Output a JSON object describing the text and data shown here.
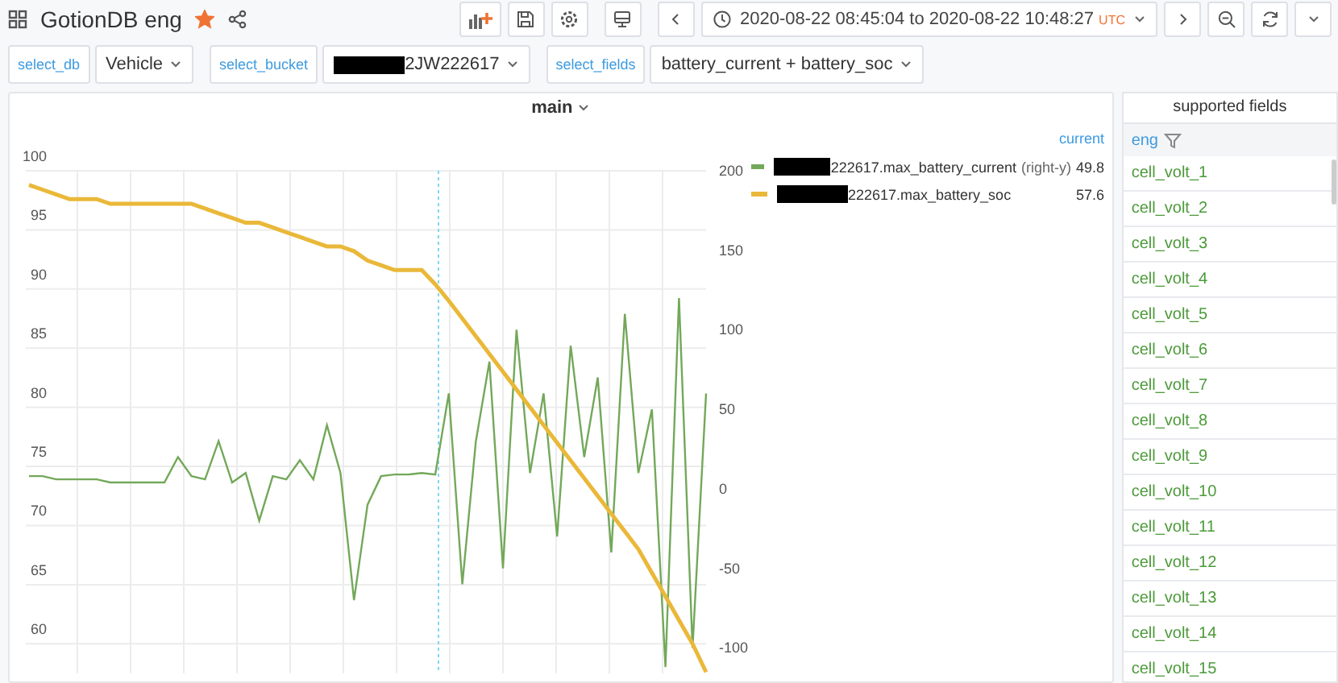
{
  "dashboard": {
    "title": "GotionDB eng",
    "starred": true
  },
  "time_range": {
    "text": "2020-08-22 08:45:04 to 2020-08-22 10:48:27",
    "zone": "UTC"
  },
  "variables": [
    {
      "label": "select_db",
      "value": "Vehicle"
    },
    {
      "label": "select_bucket",
      "value": "2JW222617",
      "redacted": true
    },
    {
      "label": "select_fields",
      "value": "battery_current + battery_soc"
    }
  ],
  "panel": {
    "title": "main",
    "chart_data": {
      "type": "line",
      "grid": true,
      "ylim": [
        57.5,
        100
      ],
      "yticks": [
        100,
        95,
        90,
        85,
        80,
        75,
        70,
        65,
        60
      ],
      "y2lim": [
        -116,
        200
      ],
      "y2ticks": [
        200,
        150,
        100,
        50,
        0,
        -50,
        -100
      ],
      "series": [
        {
          "name": "222617.max_battery_current",
          "axis": "y2",
          "color": "#73a85a",
          "values": [
            8,
            8,
            6,
            6,
            6,
            6,
            4,
            4,
            4,
            4,
            4,
            20,
            8,
            6,
            30,
            4,
            10,
            -20,
            8,
            6,
            18,
            6,
            40,
            10,
            -70,
            -10,
            8,
            9,
            9,
            10,
            9,
            60,
            -60,
            30,
            80,
            -50,
            100,
            10,
            60,
            -30,
            90,
            20,
            70,
            -40,
            110,
            10,
            50,
            -112,
            120,
            -100,
            60
          ]
        },
        {
          "name": "222617.max_battery_soc",
          "color": "#eab839",
          "values": [
            98.8,
            98.4,
            98,
            97.6,
            97.6,
            97.6,
            97.2,
            97.2,
            97.2,
            97.2,
            97.2,
            97.2,
            97.2,
            96.8,
            96.4,
            96,
            95.6,
            95.6,
            95.2,
            94.8,
            94.4,
            94,
            93.6,
            93.6,
            93.2,
            92.4,
            92,
            91.6,
            91.6,
            91.6,
            90.4,
            89,
            87.5,
            86,
            84.5,
            83,
            81.5,
            80,
            78.5,
            77,
            75.5,
            74,
            72.5,
            71,
            69.5,
            68,
            66,
            64,
            62,
            60,
            57.6
          ]
        }
      ]
    },
    "legend": {
      "column": "current",
      "rows": [
        {
          "axis_note": "(right-y)",
          "value": "49.8",
          "redacted": true
        },
        {
          "value": "57.6",
          "redacted": true
        }
      ]
    }
  },
  "fields_panel": {
    "title": "supported fields",
    "filter": "eng",
    "items": [
      "cell_volt_1",
      "cell_volt_2",
      "cell_volt_3",
      "cell_volt_4",
      "cell_volt_5",
      "cell_volt_6",
      "cell_volt_7",
      "cell_volt_8",
      "cell_volt_9",
      "cell_volt_10",
      "cell_volt_11",
      "cell_volt_12",
      "cell_volt_13",
      "cell_volt_14",
      "cell_volt_15"
    ]
  }
}
